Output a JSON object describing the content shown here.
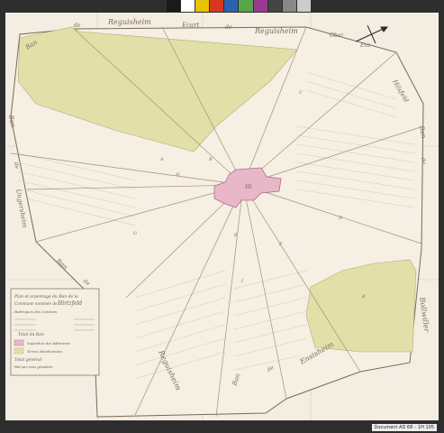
{
  "map": {
    "border_labels": {
      "top_left": "Reguisheim",
      "top_mid": "Ecart",
      "top_de1": "de",
      "top_right": "Reguisheim",
      "right_top1": "Ober",
      "right_top2": "Enz",
      "right_top3": "Hilsfeld",
      "ban_right": "Ban",
      "de_right": "de",
      "bollwiller": "Bollwiller",
      "ban_left": "Ban",
      "de_left": "de",
      "ungersheim": "Ungersheim",
      "ban_top_left": "Ban",
      "de_top_left": "de",
      "ban_bottom": "Ban",
      "de_bottom": "de",
      "ensisheim": "Ensisheim",
      "bottom_left_reg": "Reguisheim",
      "left_bottom_ban": "Ban",
      "left_bottom_de": "de"
    },
    "village": "Ht",
    "letters": [
      "A",
      "B",
      "C",
      "D",
      "E",
      "F",
      "G",
      "H",
      "I",
      "K"
    ],
    "legend": {
      "title1": "Plan et arpentage du Ban de la",
      "title2": "Commune nommée de",
      "title3": "Hirtzfeld",
      "line1": "Rubriques des Cantons",
      "line2": "Total du Ban",
      "line3": "Superficie des bâtiments",
      "line4": "Terres abandonnées",
      "line5": "Total général",
      "line6": "Fait par nous géomètre"
    },
    "reference": "Document AD 68 – 1H 105"
  },
  "colors": {
    "paper": "#f3ede2",
    "field": "#e3dfa8",
    "village": "#e8b8c8",
    "line": "#a89070",
    "border": "#7a6a55"
  },
  "colorbar": [
    "#1a1a1a",
    "#ffffff",
    "#e6c400",
    "#d6381f",
    "#2a62b0",
    "#59a34a",
    "#9a3a93",
    "#444444",
    "#888888",
    "#cccccc"
  ]
}
